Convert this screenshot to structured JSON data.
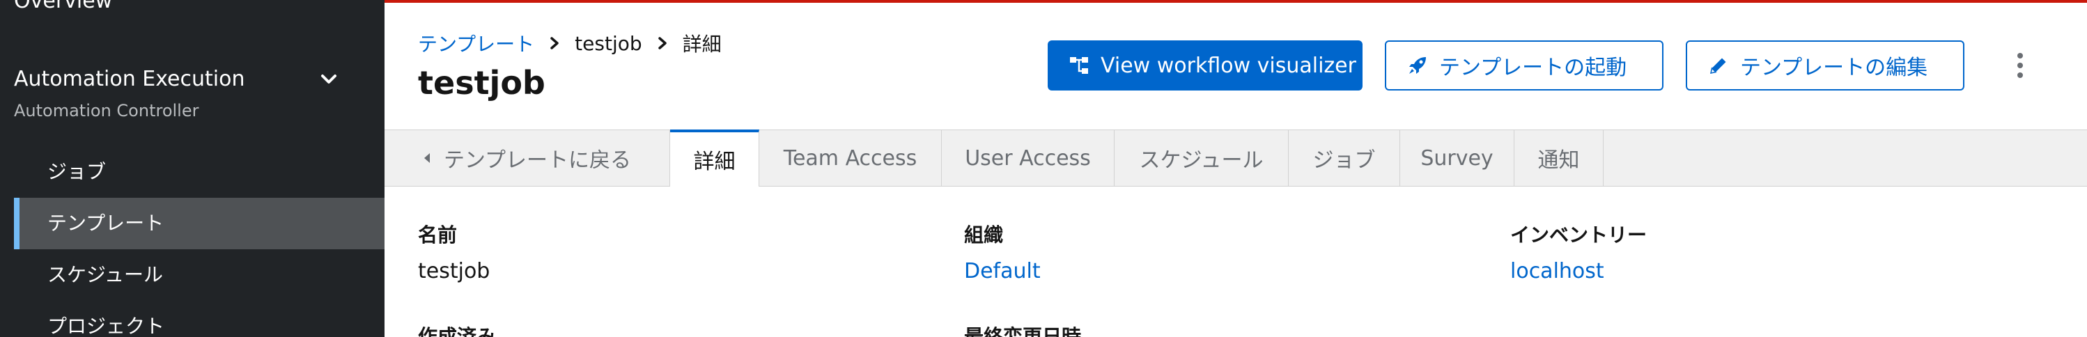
{
  "sidebar": {
    "overview": "Overview",
    "section_title": "Automation Execution",
    "section_sub": "Automation Controller",
    "items": [
      {
        "label": "ジョブ"
      },
      {
        "label": "テンプレート"
      },
      {
        "label": "スケジュール"
      },
      {
        "label": "プロジェクト"
      }
    ]
  },
  "breadcrumb": {
    "root": "テンプレート",
    "job": "testjob",
    "current": "詳細"
  },
  "page_title": "testjob",
  "actions": {
    "visualizer": "View workflow visualizer",
    "launch": "テンプレートの起動",
    "edit": "テンプレートの編集"
  },
  "tabs": {
    "back": "テンプレートに戻る",
    "details": "詳細",
    "team_access": "Team Access",
    "user_access": "User Access",
    "schedules": "スケジュール",
    "jobs": "ジョブ",
    "survey": "Survey",
    "notifications": "通知"
  },
  "details": {
    "name_label": "名前",
    "name_value": "testjob",
    "org_label": "組織",
    "org_value": "Default",
    "inventory_label": "インベントリー",
    "inventory_value": "localhost",
    "created_label": "作成済み",
    "modified_label": "最終変更日時"
  },
  "colors": {
    "brand_red": "#c9190b",
    "primary": "#0066cc",
    "sidebar_bg": "#212427",
    "active_indicator": "#73bcf7"
  }
}
